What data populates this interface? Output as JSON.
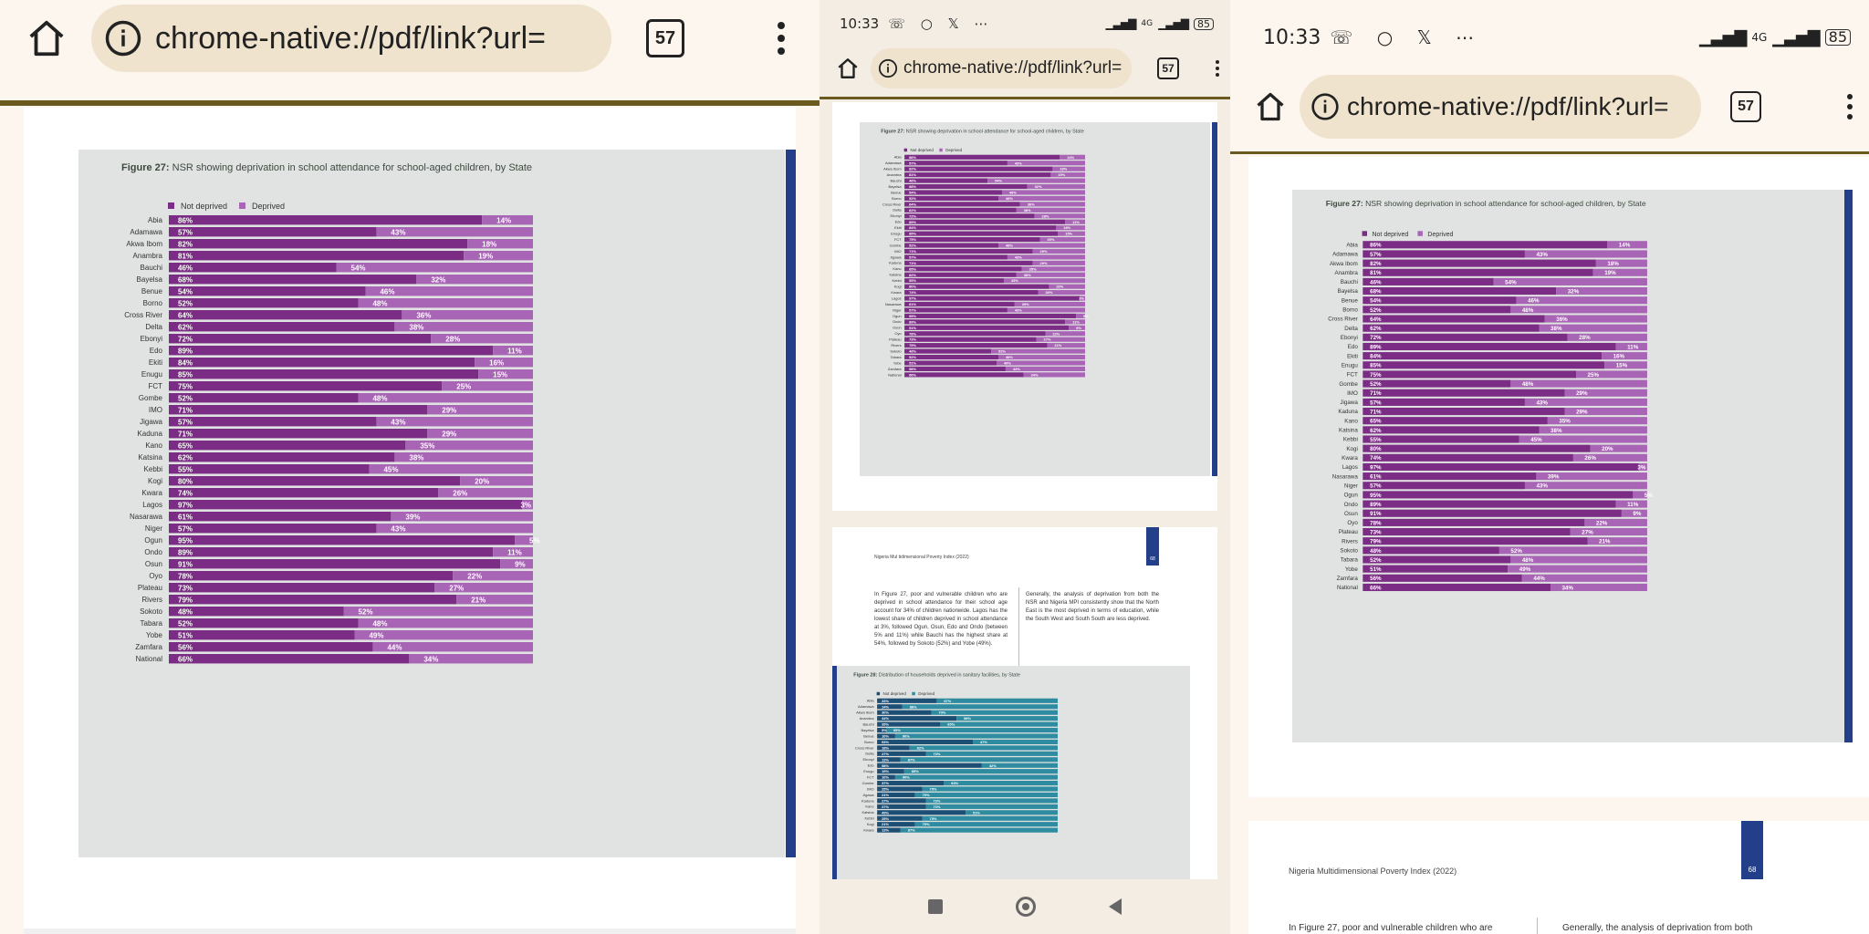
{
  "browser": {
    "url": "chrome-native://pdf/link?url=",
    "tab_count": "57",
    "time": "10:33",
    "battery": "85",
    "network": "4G"
  },
  "icons": {
    "home": "home-icon",
    "info": "info-icon",
    "menu": "more-vert-icon",
    "notif": [
      "whatsapp-icon",
      "circle-icon",
      "x-icon",
      "more-icon"
    ]
  },
  "colors": {
    "not_deprived": "#7b2c84",
    "deprived": "#a865b5",
    "sanitary_not_deprived": "#1d4e74",
    "sanitary_deprived": "#2f8ca0",
    "accent_band": "#233f8a"
  },
  "figure27": {
    "title_bold": "Figure 27:",
    "title_rest": " NSR showing deprivation in school attendance for school-aged children, by State",
    "legend": [
      "Not deprived",
      "Deprived"
    ]
  },
  "chart_data": [
    {
      "type": "bar",
      "stacked": true,
      "orientation": "horizontal",
      "title": "Figure 27: NSR showing deprivation in school attendance for school-aged children, by State",
      "categories": [
        "Abia",
        "Adamawa",
        "Akwa Ibom",
        "Anambra",
        "Bauchi",
        "Bayelsa",
        "Benue",
        "Borno",
        "Cross River",
        "Delta",
        "Ebonyi",
        "Edo",
        "Ekiti",
        "Enugu",
        "FCT",
        "Gombe",
        "IMO",
        "Jigawa",
        "Kaduna",
        "Kano",
        "Katsina",
        "Kebbi",
        "Kogi",
        "Kwara",
        "Lagos",
        "Nasarawa",
        "Niger",
        "Ogun",
        "Ondo",
        "Osun",
        "Oyo",
        "Plateau",
        "Rivers",
        "Sokoto",
        "Tabara",
        "Yobe",
        "Zamfara",
        "National"
      ],
      "series": [
        {
          "name": "Not deprived",
          "values": [
            86,
            57,
            82,
            81,
            46,
            68,
            54,
            52,
            64,
            62,
            72,
            89,
            84,
            85,
            75,
            52,
            71,
            57,
            71,
            65,
            62,
            55,
            80,
            74,
            97,
            61,
            57,
            95,
            89,
            91,
            78,
            73,
            79,
            48,
            52,
            51,
            56,
            66
          ]
        },
        {
          "name": "Deprived",
          "values": [
            14,
            43,
            18,
            19,
            54,
            32,
            46,
            48,
            36,
            38,
            28,
            11,
            16,
            15,
            25,
            48,
            29,
            43,
            29,
            35,
            38,
            45,
            20,
            26,
            3,
            39,
            43,
            5,
            11,
            9,
            22,
            27,
            21,
            52,
            48,
            49,
            44,
            34
          ]
        }
      ],
      "xlim": [
        0,
        100
      ]
    },
    {
      "type": "bar",
      "stacked": true,
      "orientation": "horizontal",
      "title": "Figure 28: Distribution of households deprived in sanitary facilities, by State",
      "categories": [
        "Abia",
        "Adamawa",
        "Akwa Ibom",
        "Anambra",
        "Bauchi",
        "Bayelsa",
        "Benue",
        "Borno",
        "Cross River",
        "Delta",
        "Ebonyi",
        "Edo",
        "Enugu",
        "FCT",
        "Gombe",
        "IMO",
        "Jigawa",
        "Kaduna",
        "Kano",
        "Katsina",
        "Kebbi",
        "Kogi",
        "Kwara"
      ],
      "series": [
        {
          "name": "Not deprived",
          "values": [
            33,
            14,
            30,
            44,
            35,
            5,
            10,
            53,
            18,
            27,
            13,
            58,
            15,
            10,
            37,
            25,
            21,
            27,
            27,
            49,
            25,
            21,
            13,
            25
          ]
        },
        {
          "name": "Deprived",
          "values": [
            67,
            86,
            70,
            56,
            65,
            95,
            90,
            47,
            82,
            73,
            87,
            42,
            85,
            90,
            63,
            75,
            79,
            73,
            73,
            51,
            75,
            79,
            87,
            75
          ]
        }
      ],
      "xlim": [
        0,
        100
      ]
    }
  ],
  "figure28": {
    "title_bold": "Figure 28:",
    "title_rest": " Distribution of households deprived in sanitary facilities, by State",
    "legend": [
      "Not deprived",
      "Deprived"
    ]
  },
  "page_header": "Nigeria Multidimensional Poverty Index (2022)",
  "page_header_short": "Nigeria Mul tidimensional Poverty Index (2022)",
  "page_number": "68",
  "para_left": "In Figure 27, poor and vulnerable children who are deprived in school attendance for their school age account for 34% of children nationwide. Lagos has the lowest share of children deprived in school attendance at 3%, followed Ogun, Osun, Edo and Ondo (between 5% and 11%) while Bauchi has the highest share at 54%, followed by Sokoto (52%) and Yobe (49%).",
  "para_right": "Generally, the analysis of deprivation from both the NSR and Nigeria MPI consistently show that the North East is the most deprived in terms of education, while the South West and South South are less deprived.",
  "para_left_s3": "In Figure 27, poor and vulnerable children who are",
  "para_right_s3": "Generally, the analysis of deprivation from both"
}
